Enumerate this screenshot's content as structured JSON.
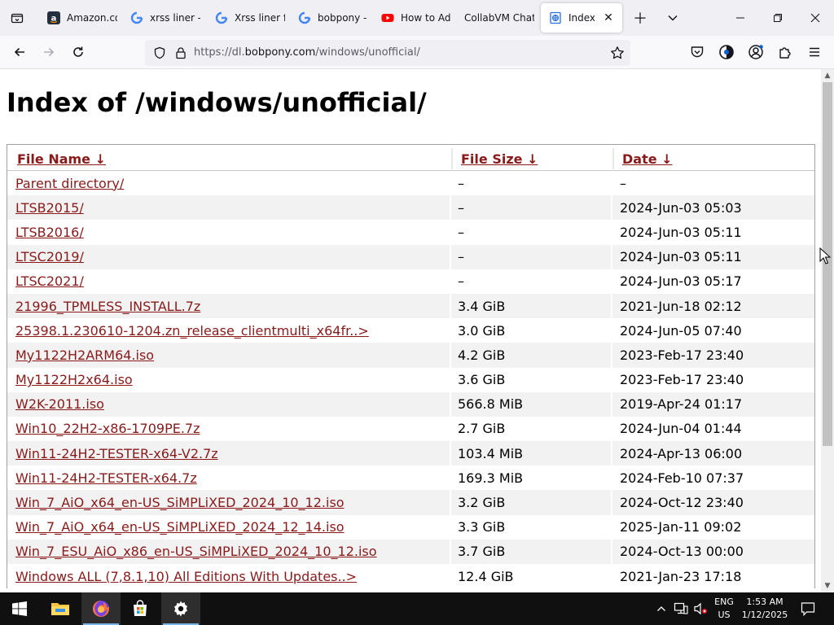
{
  "tabs": [
    {
      "title": "Amazon.com",
      "favicon": "amazon-icon"
    },
    {
      "title": "xrss liner - Google",
      "favicon": "google-icon"
    },
    {
      "title": "Xrss liner for",
      "favicon": "google-icon"
    },
    {
      "title": "bobpony - Google",
      "favicon": "google-icon"
    },
    {
      "title": "How to Add",
      "favicon": "youtube-icon"
    },
    {
      "title": "CollabVM Chat",
      "favicon": ""
    },
    {
      "title": "Index of /windows/unofficial/",
      "favicon": "page-icon",
      "active": true
    }
  ],
  "address": {
    "prefix": "https://dl.",
    "host": "bobpony.com",
    "path": "/windows/unofficial/"
  },
  "page": {
    "title": "Index of /windows/unofficial/",
    "columns": {
      "name": "File Name  ↓",
      "size": "File Size  ↓",
      "date": "Date  ↓"
    },
    "rows": [
      {
        "name": "Parent directory/",
        "size": "–",
        "date": "–"
      },
      {
        "name": "LTSB2015/",
        "size": "–",
        "date": "2024-Jun-03 05:03"
      },
      {
        "name": "LTSB2016/",
        "size": "–",
        "date": "2024-Jun-03 05:11"
      },
      {
        "name": "LTSC2019/",
        "size": "–",
        "date": "2024-Jun-03 05:11"
      },
      {
        "name": "LTSC2021/",
        "size": "–",
        "date": "2024-Jun-03 05:17"
      },
      {
        "name": "21996_TPMLESS_INSTALL.7z",
        "size": "3.4 GiB",
        "date": "2021-Jun-18 02:12"
      },
      {
        "name": "25398.1.230610-1204.zn_release_clientmulti_x64fr..>",
        "size": "3.0 GiB",
        "date": "2024-Jun-05 07:40"
      },
      {
        "name": "My1122H2ARM64.iso",
        "size": "4.2 GiB",
        "date": "2023-Feb-17 23:40"
      },
      {
        "name": "My1122H2x64.iso",
        "size": "3.6 GiB",
        "date": "2023-Feb-17 23:40"
      },
      {
        "name": "W2K-2011.iso",
        "size": "566.8 MiB",
        "date": "2019-Apr-24 01:17"
      },
      {
        "name": "Win10_22H2-x86-1709PE.7z",
        "size": "2.7 GiB",
        "date": "2024-Jun-04 01:44"
      },
      {
        "name": "Win11-24H2-TESTER-x64-V2.7z",
        "size": "103.4 MiB",
        "date": "2024-Apr-13 06:00"
      },
      {
        "name": "Win11-24H2-TESTER-x64.7z",
        "size": "169.3 MiB",
        "date": "2024-Feb-10 07:37"
      },
      {
        "name": "Win_7_AiO_x64_en-US_SiMPLiXED_2024_10_12.iso",
        "size": "3.2 GiB",
        "date": "2024-Oct-12 23:40"
      },
      {
        "name": "Win_7_AiO_x64_en-US_SiMPLiXED_2024_12_14.iso",
        "size": "3.3 GiB",
        "date": "2025-Jan-11 09:02"
      },
      {
        "name": "Win_7_ESU_AiO_x86_en-US_SiMPLiXED_2024_10_12.iso",
        "size": "3.7 GiB",
        "date": "2024-Oct-13 00:00"
      },
      {
        "name": "Windows ALL (7,8.1,10) All Editions With Updates..>",
        "size": "12.4 GiB",
        "date": "2021-Jan-23 17:18"
      }
    ]
  },
  "taskbar": {
    "lang_line1": "ENG",
    "lang_line2": "US",
    "time": "1:53 AM",
    "date": "1/12/2025"
  },
  "colors": {
    "link": "#8a1a1a",
    "row_alt": "#f2f2f2",
    "taskbar": "#101010"
  }
}
